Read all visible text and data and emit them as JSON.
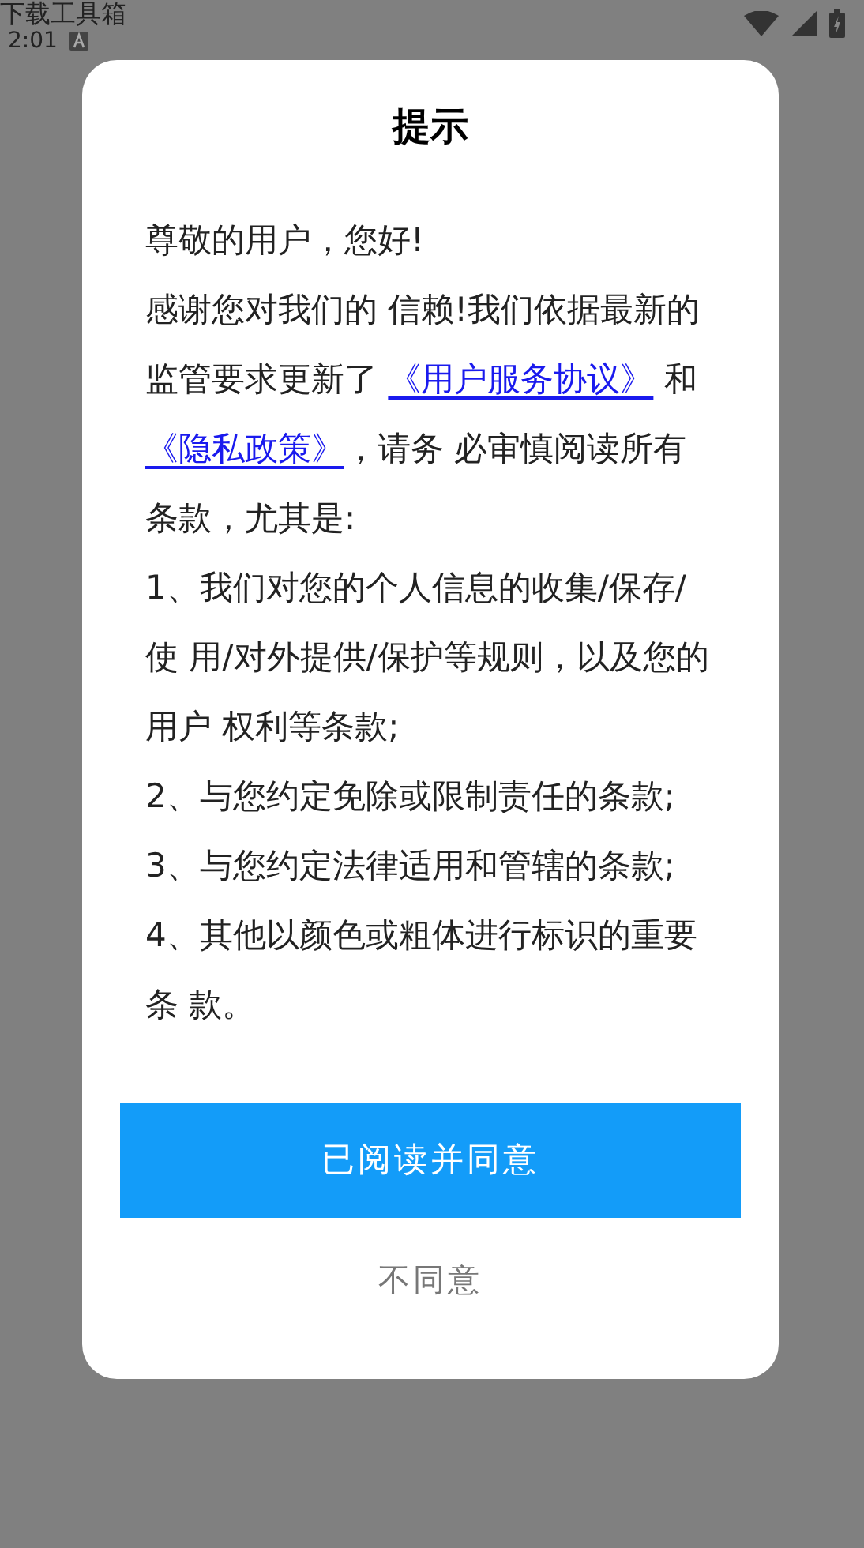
{
  "status_bar": {
    "app_title": "下载工具箱",
    "time": "2:01"
  },
  "dialog": {
    "title": "提示",
    "body": [
      {
        "kind": "text",
        "text": "尊敬的用户，您好!"
      },
      {
        "kind": "rich",
        "parts": [
          {
            "kind": "text",
            "text": "感谢您对我们的 信赖!我们依据最新的监管要求更新了 "
          },
          {
            "kind": "link",
            "text": "《用户服务协议》"
          },
          {
            "kind": "text",
            "text": " 和 "
          },
          {
            "kind": "link",
            "text": "《隐私政策》"
          },
          {
            "kind": "text",
            "text": "，请务 必审慎阅读所有条款，尤其是:"
          }
        ]
      },
      {
        "kind": "text",
        "text": " 1、我们对您的个人信息的收集/保存/使 用/对外提供/保护等规则，以及您的用户 权利等条款;"
      },
      {
        "kind": "text",
        "text": " 2、与您约定免除或限制责任的条款;"
      },
      {
        "kind": "text",
        "text": " 3、与您约定法律适用和管辖的条款;"
      },
      {
        "kind": "text",
        "text": " 4、其他以颜色或粗体进行标识的重要条 款。"
      }
    ],
    "agree_button": "已阅读并同意",
    "decline_button": "不同意"
  }
}
